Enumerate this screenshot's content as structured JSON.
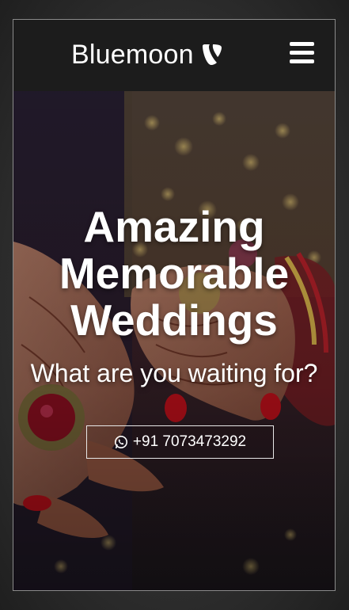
{
  "header": {
    "brand_name": "Bluemoon",
    "brand_icon": "typo3-logo-icon",
    "menu_icon": "hamburger-menu-icon"
  },
  "hero": {
    "title_lines": [
      "Amazing",
      "Memorable",
      "Weddings"
    ],
    "subtitle": "What are you waiting for?",
    "phone_label": "+91 7073473292",
    "phone_icon": "whatsapp-icon"
  },
  "colors": {
    "header_bg": "#1c1c1c",
    "text": "#ffffff",
    "frame_border": "#8a8a8a"
  }
}
